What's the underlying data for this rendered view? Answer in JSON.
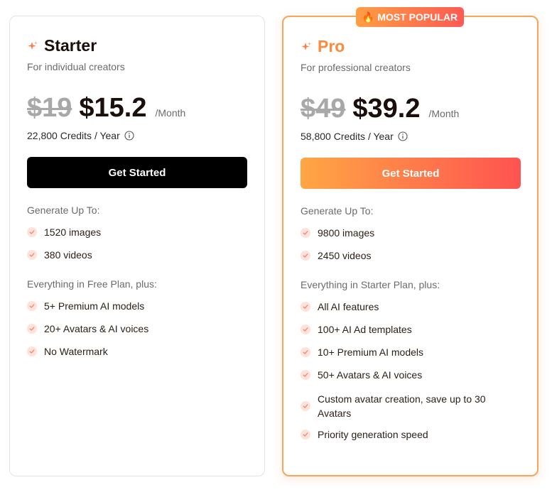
{
  "badge": {
    "icon": "flame-icon",
    "label": "MOST POPULAR"
  },
  "plans": {
    "starter": {
      "icon": "sparkle-icon",
      "name": "Starter",
      "subtitle": "For individual creators",
      "old_price": "$19",
      "new_price": "$15.2",
      "period": "/Month",
      "credits": "22,800 Credits / Year",
      "cta": "Get Started",
      "generate_label": "Generate Up To:",
      "generate_items": [
        "1520 images",
        "380 videos"
      ],
      "features_label": "Everything in Free Plan, plus:",
      "features": [
        "5+ Premium AI models",
        "20+ Avatars & AI voices",
        "No Watermark"
      ]
    },
    "pro": {
      "icon": "sparkle-icon",
      "name": "Pro",
      "subtitle": "For professional creators",
      "old_price": "$49",
      "new_price": "$39.2",
      "period": "/Month",
      "credits": "58,800 Credits / Year",
      "cta": "Get Started",
      "generate_label": "Generate Up To:",
      "generate_items": [
        "9800 images",
        "2450 videos"
      ],
      "features_label": "Everything in Starter Plan, plus:",
      "features": [
        "All AI features",
        "100+ AI Ad templates",
        "10+ Premium AI models",
        "50+ Avatars & AI voices",
        "Custom avatar creation, save up to 30 Avatars",
        "Priority generation speed"
      ]
    }
  },
  "colors": {
    "accent_orange": "#ff8a3d",
    "gradient_start": "#ffa644",
    "gradient_end": "#ff5350",
    "check_bg": "#fde3da",
    "check_mark": "#f0826a"
  }
}
